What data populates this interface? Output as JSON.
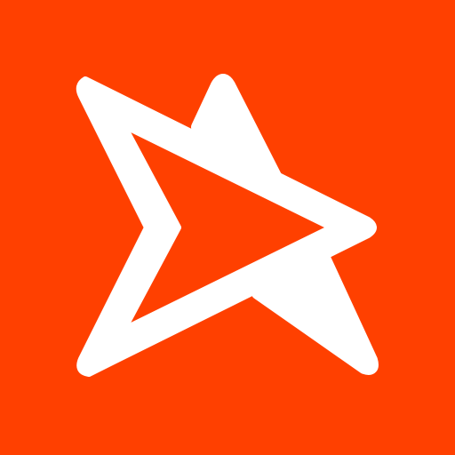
{
  "icon": {
    "name": "play-star-logo-icon",
    "background_color": "#FF4000",
    "glyph_color": "#FFFFFF"
  }
}
